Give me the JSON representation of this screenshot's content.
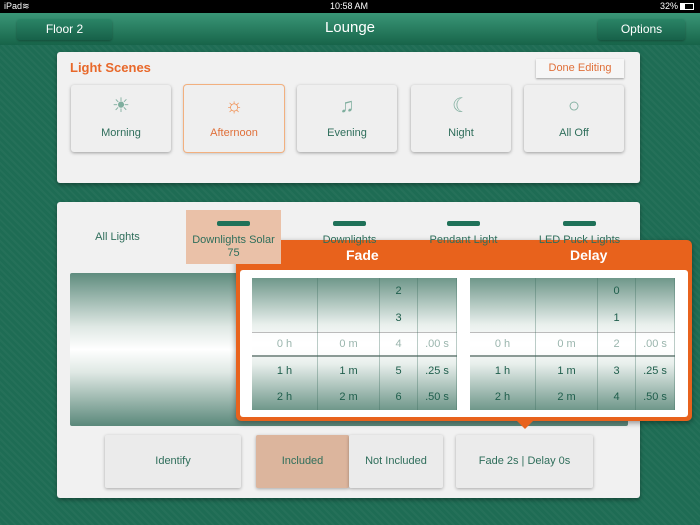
{
  "status": {
    "device": "iPad",
    "time": "10:58 AM",
    "battery": "32%"
  },
  "nav": {
    "back_label": "Floor 2",
    "title": "Lounge",
    "options_label": "Options"
  },
  "scenes": {
    "title": "Light Scenes",
    "done_label": "Done Editing",
    "items": [
      {
        "label": "Morning",
        "icon": "sunrise-icon",
        "glyph": "☀"
      },
      {
        "label": "Afternoon",
        "icon": "sun-icon",
        "glyph": "☼"
      },
      {
        "label": "Evening",
        "icon": "music-note-icon",
        "glyph": "♫"
      },
      {
        "label": "Night",
        "icon": "moon-icon",
        "glyph": "☾"
      },
      {
        "label": "All Off",
        "icon": "circle-icon",
        "glyph": "○"
      }
    ],
    "selected": "Afternoon"
  },
  "lights": {
    "tabs": [
      {
        "label": "All Lights"
      },
      {
        "label": "Downlights Solar",
        "sub": "75"
      },
      {
        "label": "Downlights"
      },
      {
        "label": "Pendant Light"
      },
      {
        "label": "LED Puck Lights"
      }
    ],
    "selected": "Downlights Solar"
  },
  "buttons": {
    "identify": "Identify",
    "included": "Included",
    "not_included": "Not Included",
    "fade_delay": "Fade 2s | Delay 0s"
  },
  "popover": {
    "fade_title": "Fade",
    "delay_title": "Delay",
    "fade": {
      "hours": [
        "0 h",
        "1 h",
        "2 h"
      ],
      "minutes": [
        "0 m",
        "1 m",
        "2 m"
      ],
      "seconds": [
        "2",
        "3",
        "4",
        "5",
        "6"
      ],
      "fractions": [
        ".00 s",
        ".25 s",
        ".50 s"
      ]
    },
    "delay": {
      "hours": [
        "0 h",
        "1 h",
        "2 h"
      ],
      "minutes": [
        "0 m",
        "1 m",
        "2 m"
      ],
      "seconds": [
        "0",
        "1",
        "2",
        "3",
        "4"
      ],
      "fractions": [
        ".00 s",
        ".25 s",
        ".50 s"
      ]
    }
  },
  "colors": {
    "accent": "#e8621c",
    "brand": "#1e6c54"
  }
}
